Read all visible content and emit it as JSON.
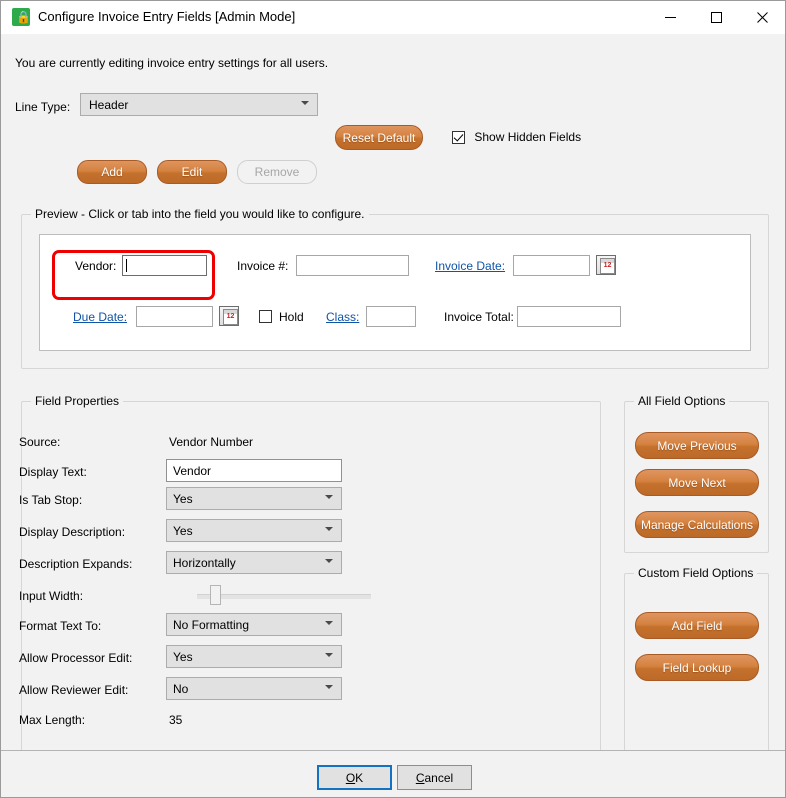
{
  "window": {
    "title": "Configure Invoice Entry Fields [Admin Mode]",
    "icon": "lock-icon",
    "minimize": "–",
    "maximize": "□",
    "close": "✕"
  },
  "notice": "You are currently editing invoice entry settings for all users.",
  "toolbar": {
    "line_type_label": "Line Type:",
    "line_type_value": "Header",
    "reset_default": "Reset Default",
    "add": "Add",
    "edit": "Edit",
    "remove": "Remove",
    "show_hidden_label": "Show Hidden Fields",
    "show_hidden_checked": true
  },
  "preview": {
    "group_label": "Preview - Click or tab into the field you would like to configure.",
    "fields": [
      {
        "label": "Vendor:",
        "link": false,
        "focused": true
      },
      {
        "label": "Invoice #:",
        "link": false,
        "focused": false
      },
      {
        "label": "Invoice Date:",
        "link": true,
        "focused": false
      },
      {
        "label": "Due Date:",
        "link": true,
        "focused": false
      },
      {
        "label": "Hold",
        "link": false,
        "focused": false
      },
      {
        "label": "Class:",
        "link": true,
        "focused": false
      },
      {
        "label": "Invoice Total:",
        "link": false,
        "focused": false
      }
    ],
    "calendar_icon_text": "12",
    "hold_checked": false,
    "highlight_color": "#ee0000"
  },
  "field_properties": {
    "group_label": "Field Properties",
    "rows": [
      {
        "label": "Source:",
        "value": "Vendor Number",
        "control": "static"
      },
      {
        "label": "Display Text:",
        "value": "Vendor",
        "control": "text"
      },
      {
        "label": "Is Tab Stop:",
        "value": "Yes",
        "control": "select"
      },
      {
        "label": "Display Description:",
        "value": "Yes",
        "control": "select"
      },
      {
        "label": "Description Expands:",
        "value": "Horizontally",
        "control": "select"
      },
      {
        "label": "Input Width:",
        "value": "",
        "control": "slider"
      },
      {
        "label": "Format Text To:",
        "value": "No Formatting",
        "control": "select"
      },
      {
        "label": "Allow Processor Edit:",
        "value": "Yes",
        "control": "select"
      },
      {
        "label": "Allow Reviewer Edit:",
        "value": "No",
        "control": "select"
      },
      {
        "label": "Max Length:",
        "value": "35",
        "control": "static"
      }
    ]
  },
  "all_field_options": {
    "group_label": "All Field Options",
    "buttons": [
      "Move Previous",
      "Move Next",
      "Manage Calculations"
    ]
  },
  "custom_field_options": {
    "group_label": "Custom Field Options",
    "buttons": [
      "Add Field",
      "Field Lookup"
    ]
  },
  "footer": {
    "ok": "OK",
    "ok_accel": "O",
    "ok_rest": "K",
    "cancel": "Cancel",
    "cancel_accel": "C",
    "cancel_rest": "ancel"
  },
  "colors": {
    "accent_orange": "#d5823f",
    "link_blue": "#0f54a8",
    "focus_blue": "#1273c4",
    "highlight_red": "#ee0000",
    "icon_green": "#2eaa4a"
  }
}
